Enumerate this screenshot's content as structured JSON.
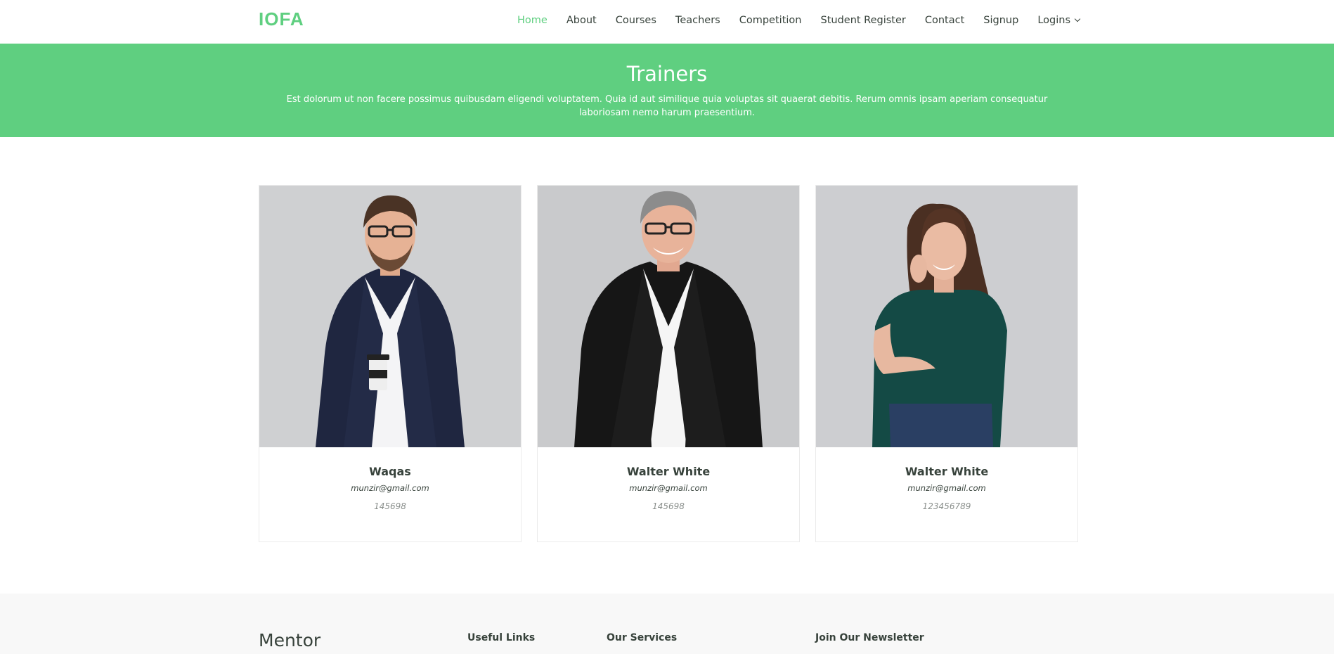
{
  "header": {
    "logo": "IOFA",
    "nav": [
      {
        "label": "Home",
        "active": true
      },
      {
        "label": "About"
      },
      {
        "label": "Courses"
      },
      {
        "label": "Teachers"
      },
      {
        "label": "Competition"
      },
      {
        "label": "Student Register"
      },
      {
        "label": "Contact"
      },
      {
        "label": "Signup"
      },
      {
        "label": "Logins",
        "dropdown": true
      }
    ]
  },
  "banner": {
    "title": "Trainers",
    "text": "Est dolorum ut non facere possimus quibusdam eligendi voluptatem. Quia id aut similique quia voluptas sit quaerat debitis. Rerum omnis ipsam aperiam consequatur laboriosam nemo harum praesentium."
  },
  "trainers": [
    {
      "name": "Waqas",
      "email": "munzir@gmail.com",
      "phone": "145698"
    },
    {
      "name": "Walter White",
      "email": "munzir@gmail.com",
      "phone": "145698"
    },
    {
      "name": "Walter White",
      "email": "munzir@gmail.com",
      "phone": "123456789"
    }
  ],
  "footer": {
    "brand": "Mentor",
    "columns": [
      "Useful Links",
      "Our Services",
      "Join Our Newsletter"
    ]
  },
  "colors": {
    "accent": "#5fcf80",
    "text": "#37423b",
    "photo_bg": "#cccdcf"
  },
  "icons": [
    "chevron-down-icon"
  ]
}
